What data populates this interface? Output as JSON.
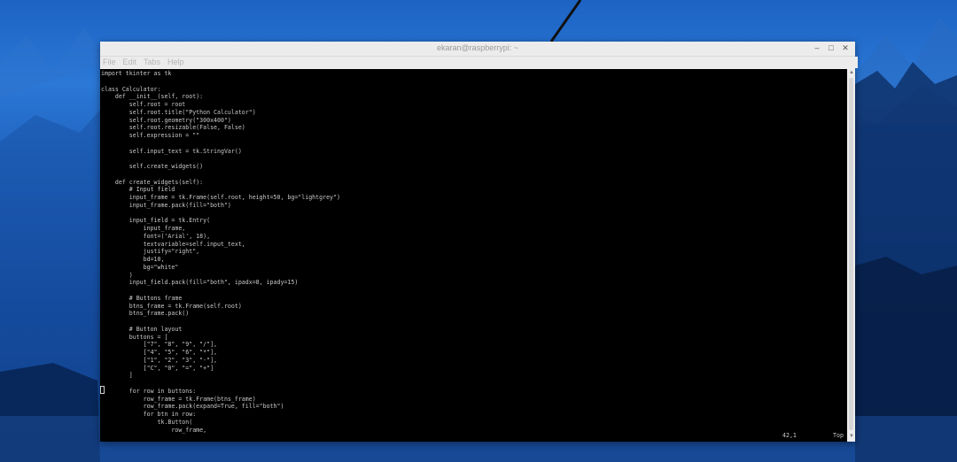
{
  "window": {
    "title": "ekaran@raspberrypi: ~",
    "controls": {
      "minimize": "–",
      "maximize": "□",
      "close": "✕"
    }
  },
  "menu": [
    "File",
    "Edit",
    "Tabs",
    "Help"
  ],
  "code_lines": [
    "import tkinter as tk",
    "",
    "class Calculator:",
    "    def __init__(self, root):",
    "        self.root = root",
    "        self.root.title(\"Python Calculator\")",
    "        self.root.geometry(\"300x400\")",
    "        self.root.resizable(False, False)",
    "        self.expression = \"\"",
    "",
    "        self.input_text = tk.StringVar()",
    "",
    "        self.create_widgets()",
    "",
    "    def create_widgets(self):",
    "        # Input field",
    "        input_frame = tk.Frame(self.root, height=50, bg=\"lightgrey\")",
    "        input_frame.pack(fill=\"both\")",
    "",
    "        input_field = tk.Entry(",
    "            input_frame,",
    "            font=('Arial', 18),",
    "            textvariable=self.input_text,",
    "            justify=\"right\",",
    "            bd=10,",
    "            bg=\"white\"",
    "        )",
    "        input_field.pack(fill=\"both\", ipadx=8, ipady=15)",
    "",
    "        # Buttons frame",
    "        btns_frame = tk.Frame(self.root)",
    "        btns_frame.pack()",
    "",
    "        # Button layout",
    "        buttons = [",
    "            [\"7\", \"8\", \"9\", \"/\"],",
    "            [\"4\", \"5\", \"6\", \"*\"],",
    "            [\"1\", \"2\", \"3\", \"-\"],",
    "            [\"C\", \"0\", \"=\", \"+\"]",
    "        ]",
    "",
    "        for row in buttons:",
    "            row_frame = tk.Frame(btns_frame)",
    "            row_frame.pack(expand=True, fill=\"both\")",
    "            for btn in row:",
    "                tk.Button(",
    "                    row_frame,"
  ],
  "status": {
    "position": "42,1",
    "scroll": "Top"
  },
  "colors": {
    "terminal_bg": "#000000",
    "terminal_fg": "#c8c8c8",
    "wallpaper": "#1c5cb6"
  }
}
